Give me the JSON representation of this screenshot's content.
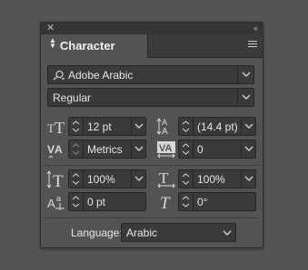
{
  "panel": {
    "title": "Character",
    "font_family": "Adobe Arabic",
    "font_style": "Regular",
    "font_size": "12 pt",
    "leading": "(14.4 pt)",
    "kerning": "Metrics",
    "tracking": "0",
    "vertical_scale": "100%",
    "horizontal_scale": "100%",
    "baseline_shift": "0 pt",
    "skew": "0°",
    "language_label": "Language:",
    "language": "Arabic"
  },
  "colors": {
    "panel_bg": "#535353",
    "field_bg": "#3a3a3a",
    "text": "#e6e6e6"
  },
  "icons": [
    "close-icon",
    "collapse-icon",
    "panel-menu-icon",
    "search-icon",
    "font-size-icon",
    "leading-icon",
    "kerning-icon",
    "tracking-icon",
    "vertical-scale-icon",
    "horizontal-scale-icon",
    "baseline-shift-icon",
    "skew-icon"
  ]
}
